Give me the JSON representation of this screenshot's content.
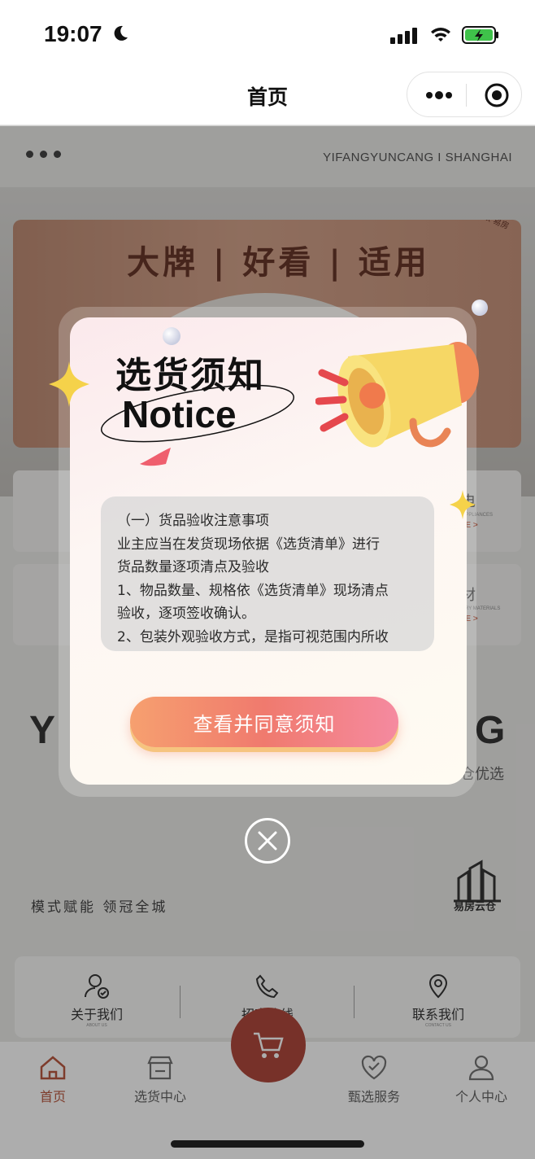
{
  "status_bar": {
    "time": "19:07"
  },
  "nav": {
    "title": "首页"
  },
  "page": {
    "brand_line": "YIFANGYUNCANG  I  SHANGHAI",
    "banner": {
      "title": "大牌 | 好看 | 适用",
      "tagline": "选择好品牌 更放心 x 易房云仓优选"
    },
    "categories": [
      {
        "name": "家电",
        "en": "HOME APPLIANCES",
        "more": "MORE  >"
      },
      {
        "name": "辅材",
        "en": "AUXILIARY MATERIALS",
        "more": "MORE  >"
      }
    ],
    "big_left": "Y",
    "big_right": "G",
    "yixuan": "仓优选",
    "slogan": "模式赋能  领冠全城",
    "logo_text": "易房云仓",
    "contact": [
      {
        "label": "关于我们",
        "en": "ABOUT US",
        "icon": "user-check-icon"
      },
      {
        "label": "招商热线",
        "en": "",
        "icon": "phone-icon"
      },
      {
        "label": "联系我们",
        "en": "CONTACT US",
        "icon": "location-pin-icon"
      }
    ],
    "tabs": [
      {
        "label": "首页",
        "icon": "home-icon",
        "active": true
      },
      {
        "label": "选货中心",
        "icon": "store-icon",
        "active": false
      },
      {
        "label": "甄选服务",
        "icon": "heart-check-icon",
        "active": false
      },
      {
        "label": "个人中心",
        "icon": "person-icon",
        "active": false
      }
    ]
  },
  "modal": {
    "title_cn": "选货须知",
    "title_en": "Notice",
    "notice_lines": [
      "（一）货品验收注意事项",
      "业主应当在发货现场依据《选货清单》进行",
      "货品数量逐项清点及验收",
      "1、物品数量、规格依《选货清单》现场清点",
      "验收，逐项签收确认。",
      "2、包装外观验收方式，是指可视范围内所收"
    ],
    "agree_label": "查看并同意须知"
  },
  "colors": {
    "accent": "#b34a2f",
    "cart": "#a8382a",
    "button_start": "#f6a06f",
    "button_end": "#f58aa0"
  }
}
